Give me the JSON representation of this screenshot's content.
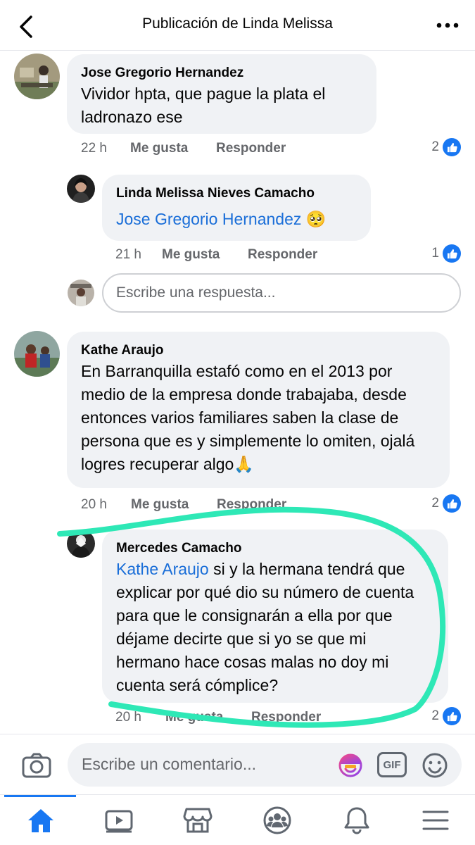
{
  "header": {
    "title": "Publicación de Linda Melissa"
  },
  "comments": [
    {
      "author": "Jose Gregorio Hernandez",
      "text": "Vividor hpta, que pague la plata el ladronazo ese",
      "time": "22 h",
      "like_label": "Me gusta",
      "reply_label": "Responder",
      "likes": "2"
    },
    {
      "author": "Linda Melissa Nieves Camacho",
      "mention": "Jose Gregorio Hernandez",
      "emoji": "🥺",
      "time": "21 h",
      "like_label": "Me gusta",
      "reply_label": "Responder",
      "likes": "1"
    },
    {
      "author": "Kathe Araujo",
      "text": "En Barranquilla estafó como en el 2013 por medio de la empresa donde trabajaba, desde entonces varios familiares saben la clase de persona que es y simplemente lo omiten, ojalá logres recuperar algo",
      "emoji": "🙏",
      "time": "20 h",
      "like_label": "Me gusta",
      "reply_label": "Responder",
      "likes": "2"
    },
    {
      "author": "Mercedes Camacho",
      "mention": "Kathe Araujo",
      "text": " si y  la hermana tendrá que explicar por qué dio su número de cuenta para que le consignarán a ella por que déjame decirte  que si yo se que mi hermano hace cosas malas no doy mi cuenta será  cómplice?",
      "time": "20 h",
      "like_label": "Me gusta",
      "reply_label": "Responder",
      "likes": "2"
    }
  ],
  "reply_input": {
    "placeholder": "Escribe una respuesta..."
  },
  "comment_input": {
    "placeholder": "Escribe un comentario..."
  },
  "gif_label": "GIF",
  "annotation_color": "#2ee8b6",
  "accent_color": "#1877f2"
}
